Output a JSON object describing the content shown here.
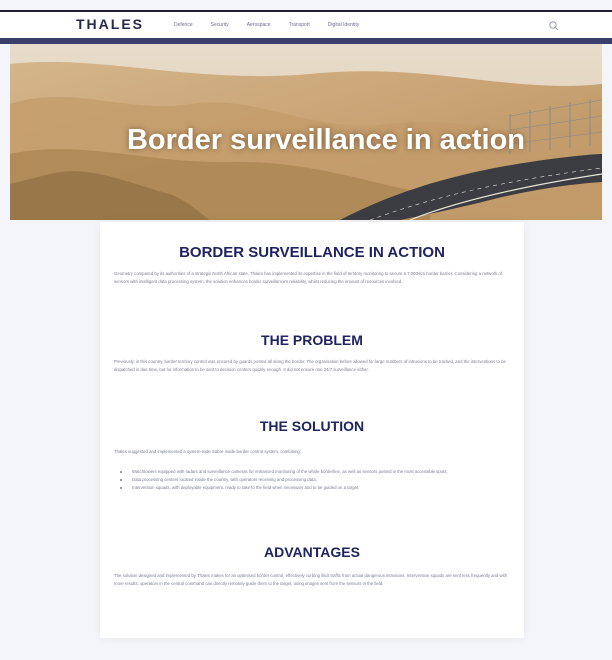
{
  "header": {
    "logo": "THALES",
    "nav_items": [
      "Defence",
      "Security",
      "Aerospace",
      "Transport",
      "Digital Identity"
    ],
    "search_icon": "search-icon"
  },
  "hero": {
    "title": "Border surveillance in action"
  },
  "article": {
    "main_heading": "BORDER SURVEILLANCE IN ACTION",
    "intro": "Geometry compared by its authorities of a strategic North African state, Thales has implemented its expertise in the field of territory monitoring to secure a 7,000-km border barrier. Considering a network of sensors with intelligent data processing system, the solution enhances border surveillance's reliability, whilst reducing the amount of resources involved.",
    "problem_heading": "THE PROBLEM",
    "problem_text": "Previously, in this country, border territory control was ensured by guards posted all along the border. The organisation before allowed for large numbers of intrusions to be tracked, and the interventions to be dispatched in due time, but for information to be sent to decision centers quickly enough. It did not ensure one 24/7 surveillance either.",
    "solution_heading": "THE SOLUTION",
    "solution_text": "Thales suggested and implemented a system-wide Sabre made border control system, combining:",
    "solution_bullets": [
      "Watchtowers equipped with radars and surveillance cameras for enhanced monitoring of the whole borderline, as well as sensors posted in the most accessible spots;",
      "Data processing centers located inside the country, with operators receiving and processing data;",
      "Intervention squads, with deployable equipment, ready to take to the field when necessary and to be guided on a target."
    ],
    "advantages_heading": "ADVANTAGES",
    "advantages_text": "The solution designed and implemented by Thales makes for an optimised border control, effectively curbing illicit traffic from actual dangerous intrusions. Intervention squads are sent less frequently and with more results: operators in the central command can directly remotely guide them to the target, using images sent from the sensors in the field."
  },
  "colors": {
    "brand_navy": "#26284d",
    "heading": "#1f2460",
    "subbar": "#3b3f6b"
  }
}
